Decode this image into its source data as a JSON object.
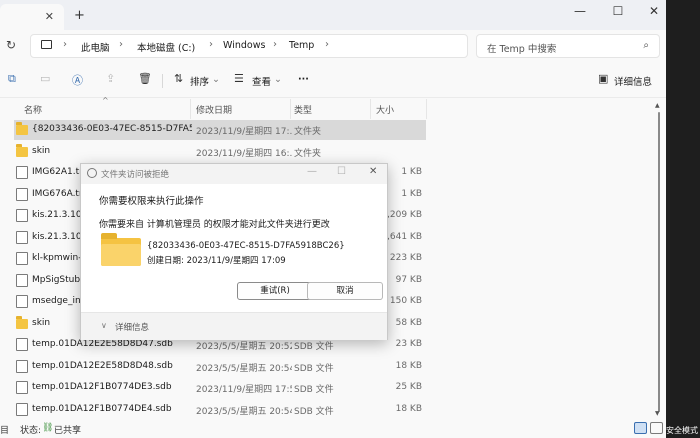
{
  "titlebar": {
    "tab_close": "✕",
    "new_tab": "+",
    "minimize": "—",
    "maximize": "☐",
    "close": "✕"
  },
  "address": {
    "refresh_icon": "↻",
    "breadcrumb": [
      "此电脑",
      "本地磁盘 (C:)",
      "Windows",
      "Temp"
    ],
    "search_placeholder": "在 Temp 中搜索",
    "search_icon": "⌕"
  },
  "toolbar": {
    "sort_label": "排序",
    "view_label": "查看",
    "more_label": "···",
    "details_label": "详细信息"
  },
  "columns": {
    "name": "名称",
    "date": "修改日期",
    "type": "类型",
    "size": "大小"
  },
  "files": [
    {
      "name": "{82033436-0E03-47EC-8515-D7FA591...",
      "date": "2023/11/9/星期四 17:...",
      "type": "文件夹",
      "size": "",
      "icon": "folder",
      "selected": true
    },
    {
      "name": "skin",
      "date": "2023/11/9/星期四 16:...",
      "type": "文件夹",
      "size": "",
      "icon": "folder"
    },
    {
      "name": "IMG62A1.tm",
      "date": "",
      "type": "",
      "size": "1 KB",
      "icon": "file"
    },
    {
      "name": "IMG676A.tm",
      "date": "",
      "type": "",
      "size": "1 KB",
      "icon": "file"
    },
    {
      "name": "kis.21.3.10.3",
      "date": "",
      "type": "",
      "size": "3,209 KB",
      "icon": "file"
    },
    {
      "name": "kis.21.3.10.3",
      "date": "",
      "type": "",
      "size": "2,641 KB",
      "icon": "file"
    },
    {
      "name": "kl-kpmwin-s",
      "date": "",
      "type": "",
      "size": "223 KB",
      "icon": "file"
    },
    {
      "name": "MpSigStub",
      "date": "",
      "type": "",
      "size": "97 KB",
      "icon": "file"
    },
    {
      "name": "msedge_inst",
      "date": "",
      "type": "",
      "size": "150 KB",
      "icon": "file"
    },
    {
      "name": "skin",
      "date": "",
      "type": "",
      "size": "58 KB",
      "icon": "folder"
    },
    {
      "name": "temp.01DA12E2E58D8D47.sdb",
      "date": "2023/5/5/星期五 20:52",
      "type": "SDB 文件",
      "size": "23 KB",
      "icon": "file"
    },
    {
      "name": "temp.01DA12E2E58D8D48.sdb",
      "date": "2023/5/5/星期五 20:54",
      "type": "SDB 文件",
      "size": "18 KB",
      "icon": "file"
    },
    {
      "name": "temp.01DA12F1B0774DE3.sdb",
      "date": "2023/11/9/星期四 17:54",
      "type": "SDB 文件",
      "size": "25 KB",
      "icon": "file"
    },
    {
      "name": "temp.01DA12F1B0774DE4.sdb",
      "date": "2023/5/5/星期五 20:54",
      "type": "SDB 文件",
      "size": "18 KB",
      "icon": "file"
    }
  ],
  "status": {
    "left": "目",
    "state_label": "状态:",
    "shared": "已共享",
    "right_text": "安全模式"
  },
  "dialog": {
    "title": "文件夹访问被拒绝",
    "minimize": "—",
    "maximize": "☐",
    "close": "✕",
    "heading": "你需要权限来执行此操作",
    "message": "你需要来自 计算机管理员 的权限才能对此文件夹进行更改",
    "folder_name": "{82033436-0E03-47EC-8515-D7FA5918BC26}",
    "folder_created": "创建日期: 2023/11/9/星期四 17:09",
    "retry_label": "重试(R)",
    "cancel_label": "取消",
    "details_chevron": "∨",
    "details_label": "详细信息"
  }
}
